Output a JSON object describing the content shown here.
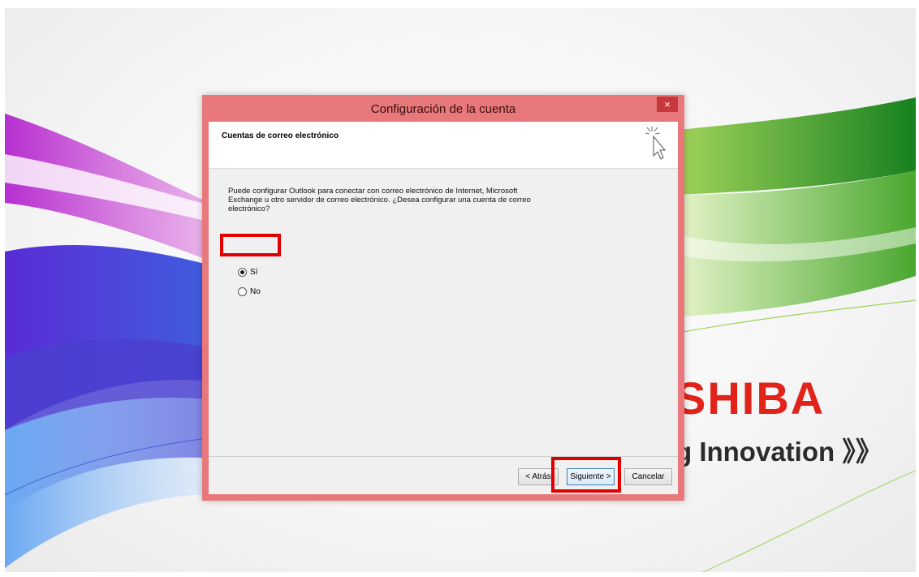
{
  "desktop": {
    "brand": "SHIBA",
    "tagline": "g Innovation 》》"
  },
  "dialog": {
    "title": "Configuración de la cuenta",
    "close_label": "×",
    "header_title": "Cuentas de correo electrónico",
    "header_icon": "wizard-cursor-icon",
    "body_text": "Puede configurar Outlook para conectar con correo electrónico de Internet, Microsoft Exchange u otro servidor de correo electrónico. ¿Desea configurar una cuenta de correo electrónico?",
    "options": [
      {
        "label": "Sí",
        "checked": true
      },
      {
        "label": "No",
        "checked": false
      }
    ],
    "buttons": {
      "back": "< Atrás",
      "next": "Siguiente >",
      "cancel": "Cancelar"
    }
  },
  "colors": {
    "titlebar": "#e8787b",
    "close_button": "#c7383c",
    "highlight": "#e00000",
    "brand": "#e2231a"
  }
}
